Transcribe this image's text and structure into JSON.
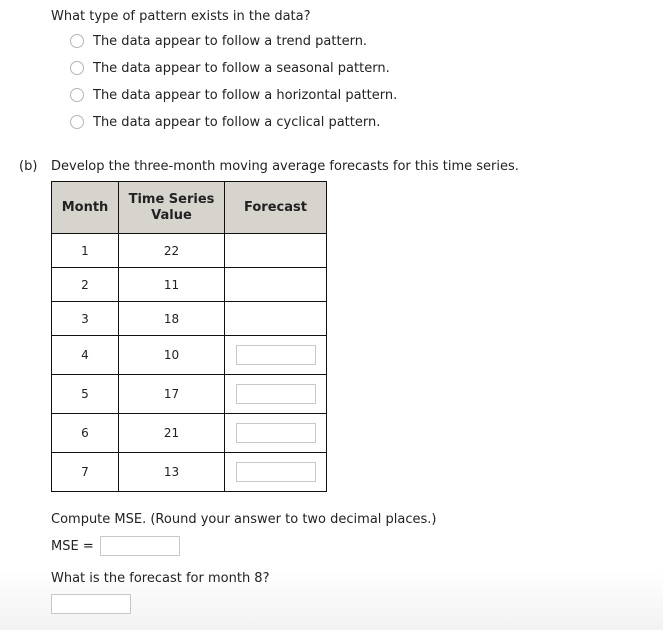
{
  "question_a": {
    "prompt": "What type of pattern exists in the data?",
    "options": [
      {
        "label": "The data appear to follow a trend pattern.",
        "selected": false
      },
      {
        "label": "The data appear to follow a seasonal pattern.",
        "selected": false
      },
      {
        "label": "The data appear to follow a horizontal pattern.",
        "selected": false
      },
      {
        "label": "The data appear to follow a cyclical pattern.",
        "selected": false
      }
    ]
  },
  "part_b": {
    "label": "(b)",
    "instruction": "Develop the three-month moving average forecasts for this time series.",
    "table": {
      "header_bg": "#d7d3cd",
      "headers": {
        "month": "Month",
        "value_line1": "Time Series",
        "value_line2": "Value",
        "forecast": "Forecast"
      },
      "rows": [
        {
          "month": "1",
          "value": "22",
          "forecast": ""
        },
        {
          "month": "2",
          "value": "11",
          "forecast": ""
        },
        {
          "month": "3",
          "value": "18",
          "forecast": ""
        },
        {
          "month": "4",
          "value": "10",
          "forecast": ""
        },
        {
          "month": "5",
          "value": "17",
          "forecast": ""
        },
        {
          "month": "6",
          "value": "21",
          "forecast": ""
        },
        {
          "month": "7",
          "value": "13",
          "forecast": ""
        }
      ]
    },
    "mse_prompt": "Compute MSE. (Round your answer to two decimal places.)",
    "mse_label": "MSE =",
    "mse_value": "",
    "month8_prompt": "What is the forecast for month 8?",
    "month8_value": ""
  }
}
